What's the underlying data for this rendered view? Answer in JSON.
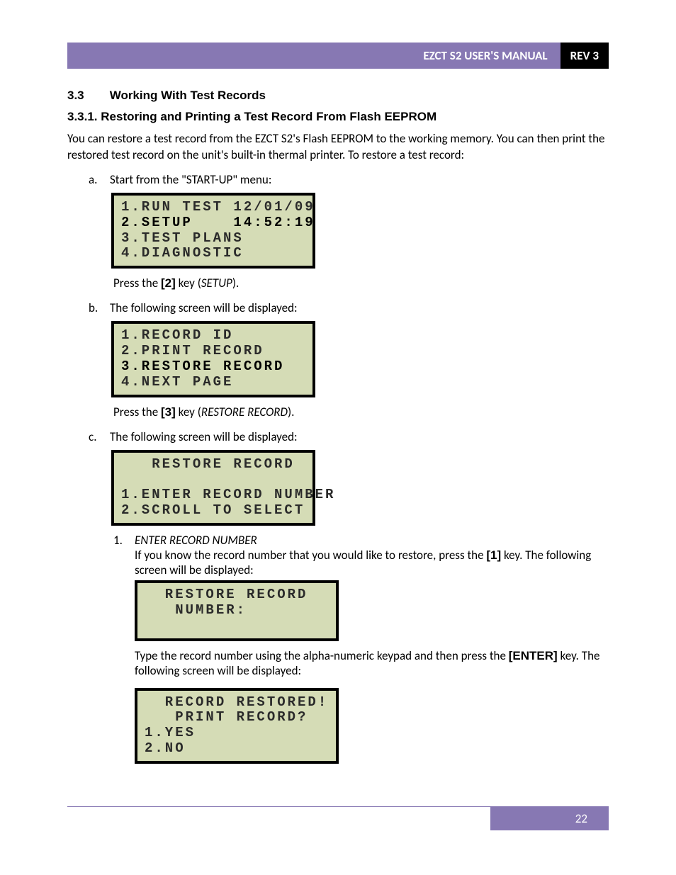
{
  "header": {
    "title": "EZCT S2 USER'S MANUAL",
    "rev": "REV 3"
  },
  "section": {
    "num": "3.3",
    "title": "Working With Test Records"
  },
  "subsection": {
    "num": "3.3.1.",
    "title": "Restoring and Printing a Test Record From Flash EEPROM"
  },
  "intro": "You can restore a test record from the EZCT S2's Flash EEPROM to the working memory. You can then print the restored test record on the unit's built-in thermal printer. To restore a test record:",
  "steps": {
    "a": {
      "text": "Start from the \"START-UP\" menu:",
      "lcd": {
        "l1": "1.RUN TEST 12/01/09",
        "l2": "2.SETUP    14:52:19",
        "l3": "3.TEST PLANS",
        "l4": "4.DIAGNOSTIC"
      },
      "after_pre": "Press the ",
      "after_key": "[2]",
      "after_mid": " key (",
      "after_italic": "SETUP",
      "after_post": ")."
    },
    "b": {
      "text": "The following screen will be displayed:",
      "lcd": {
        "l1": "1.RECORD ID",
        "l2": "2.PRINT RECORD",
        "l3": "3.RESTORE RECORD",
        "l4": "4.NEXT PAGE"
      },
      "after_pre": "Press the ",
      "after_key": "[3]",
      "after_mid": " key (",
      "after_italic": "RESTORE RECORD",
      "after_post": ")."
    },
    "c": {
      "text": "The following screen will be displayed:",
      "lcd": {
        "l1": "   RESTORE RECORD",
        "l2": "",
        "l3": "1.ENTER RECORD NUMBER",
        "l4": "2.SCROLL TO SELECT"
      },
      "sub1": {
        "label": "1.",
        "title": "ENTER RECORD NUMBER",
        "body_pre": "If you know the record number that you would like to restore, press the ",
        "body_key": "[1]",
        "body_post": " key. The following screen will be displayed:",
        "lcd1": {
          "l1": "  RESTORE RECORD",
          "l2": "   NUMBER:",
          "l3": "",
          "l4": ""
        },
        "mid_pre": "Type the record number using the alpha-numeric keypad and then press the ",
        "mid_key": "[ENTER]",
        "mid_post": " key. The following screen will be displayed:",
        "lcd2": {
          "l1": "  RECORD RESTORED!",
          "l2": "   PRINT RECORD?",
          "l3": "1.YES",
          "l4": "2.NO"
        }
      }
    }
  },
  "footer": {
    "page": "22"
  }
}
